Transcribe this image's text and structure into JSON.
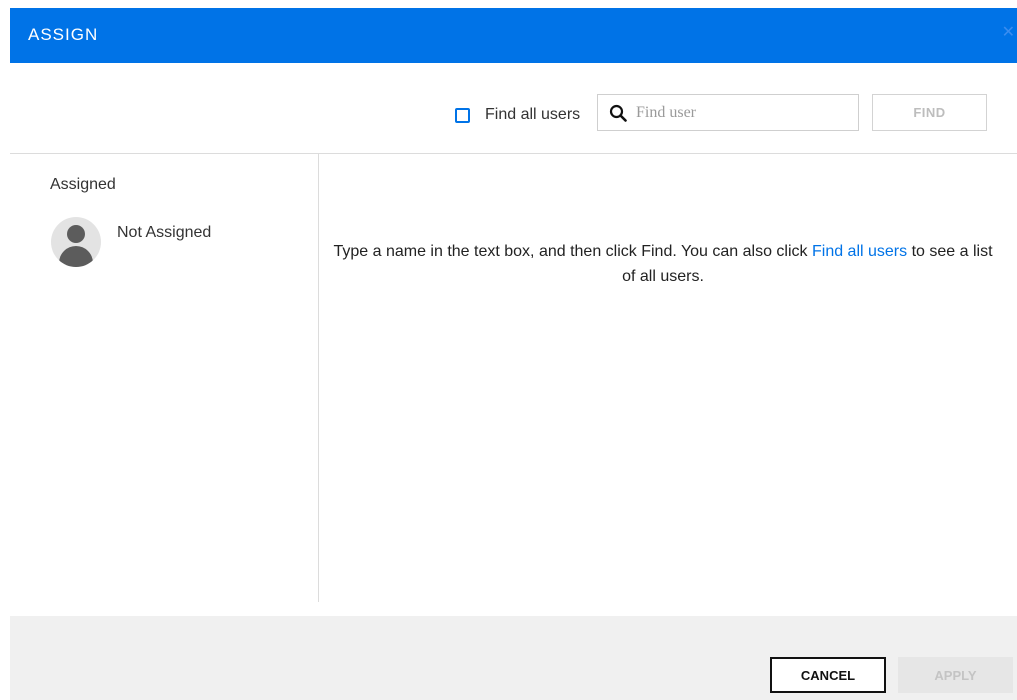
{
  "dialog": {
    "title": "ASSIGN",
    "close_icon": "close-icon",
    "accent_color": "#0073e7"
  },
  "toolbar": {
    "find_all_label": "Find all users",
    "find_all_checked": false,
    "search_placeholder": "Find user",
    "search_value": "",
    "search_icon": "search-icon",
    "find_button": "FIND"
  },
  "assigned": {
    "heading": "Assigned",
    "user_name": "Not Assigned",
    "avatar_icon": "user-avatar-icon"
  },
  "message": {
    "part1": "Type a name in the text box, and then click Find. You can also click ",
    "link": "Find all users",
    "part2": " to see a list of all users."
  },
  "footer": {
    "cancel": "CANCEL",
    "apply": "APPLY"
  }
}
